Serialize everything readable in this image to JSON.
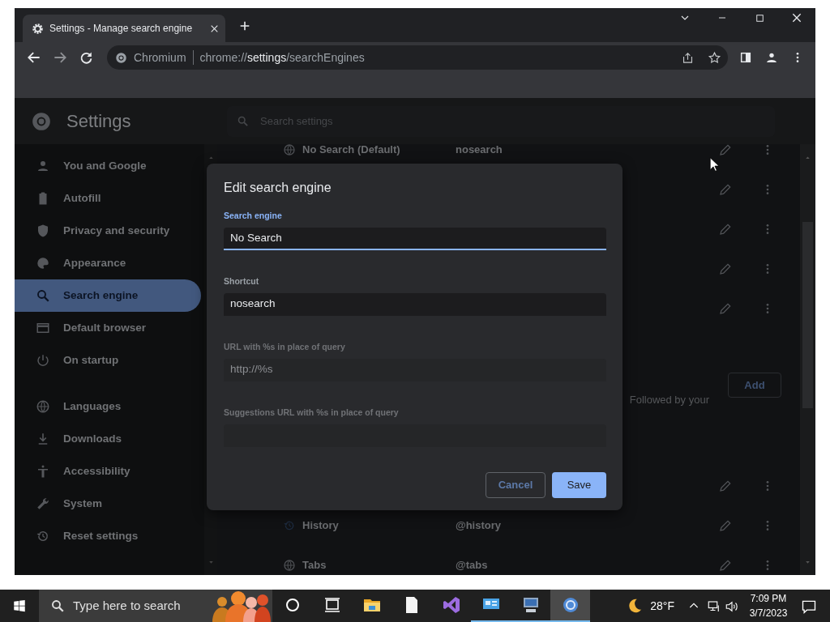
{
  "browser": {
    "tab": {
      "title": "Settings - Manage search engine",
      "selected": true
    },
    "address_bar": {
      "site_label": "Chromium",
      "url_scheme": "chrome://",
      "url_host": "settings",
      "url_path": "/searchEngines"
    }
  },
  "settings": {
    "title": "Settings",
    "search": {
      "placeholder": "Search settings"
    },
    "menu": [
      {
        "label": "You and Google",
        "selected": false
      },
      {
        "label": "Autofill",
        "selected": false
      },
      {
        "label": "Privacy and security",
        "selected": false
      },
      {
        "label": "Appearance",
        "selected": false
      },
      {
        "label": "Search engine",
        "selected": true
      },
      {
        "label": "Default browser",
        "selected": false
      },
      {
        "label": "On startup",
        "selected": false
      }
    ],
    "advanced_menu": [
      {
        "label": "Languages",
        "selected": false
      },
      {
        "label": "Downloads",
        "selected": false
      },
      {
        "label": "Accessibility",
        "selected": false
      },
      {
        "label": "System",
        "selected": false
      },
      {
        "label": "Reset settings",
        "selected": false
      }
    ],
    "engine_rows": [
      {
        "kind": "entry",
        "name": "No Search (Default)",
        "shortcut": "nosearch"
      },
      {
        "kind": "actions"
      },
      {
        "kind": "actions"
      },
      {
        "kind": "actions"
      },
      {
        "kind": "actions"
      }
    ],
    "site_search": {
      "description": "Followed by your",
      "add_button": "Add"
    },
    "site_rows": [
      {
        "kind": "actions"
      },
      {
        "kind": "entry",
        "name": "History",
        "shortcut": "@history"
      },
      {
        "kind": "entry",
        "name": "Tabs",
        "shortcut": "@tabs"
      }
    ]
  },
  "dialog": {
    "title": "Edit search engine",
    "fields": [
      {
        "label": "Search engine",
        "value": "No Search",
        "focused": true,
        "disabled": false
      },
      {
        "label": "Shortcut",
        "value": "nosearch",
        "focused": false,
        "disabled": false
      },
      {
        "label": "URL with %s in place of query",
        "value": "http://%s",
        "focused": false,
        "disabled": true
      },
      {
        "label": "Suggestions URL with %s in place of query",
        "focused": false,
        "disabled": true
      }
    ],
    "cancel_button": "Cancel",
    "save_button": "Save"
  },
  "taskbar": {
    "search": {
      "placeholder": "Type here to search"
    },
    "apps": [
      {
        "kind": "cortana",
        "running": false,
        "active": false
      },
      {
        "kind": "task-view",
        "running": false,
        "active": false
      },
      {
        "kind": "folder",
        "running": false,
        "active": false
      },
      {
        "kind": "document",
        "running": false,
        "active": false
      },
      {
        "kind": "studio",
        "running": false,
        "active": false
      },
      {
        "kind": "monitor",
        "running": true,
        "active": false
      },
      {
        "kind": "computer",
        "running": true,
        "active": false
      },
      {
        "kind": "browser",
        "running": true,
        "active": true
      }
    ],
    "weather": "28°F",
    "time": "7:09 PM",
    "date": "3/7/2023"
  }
}
